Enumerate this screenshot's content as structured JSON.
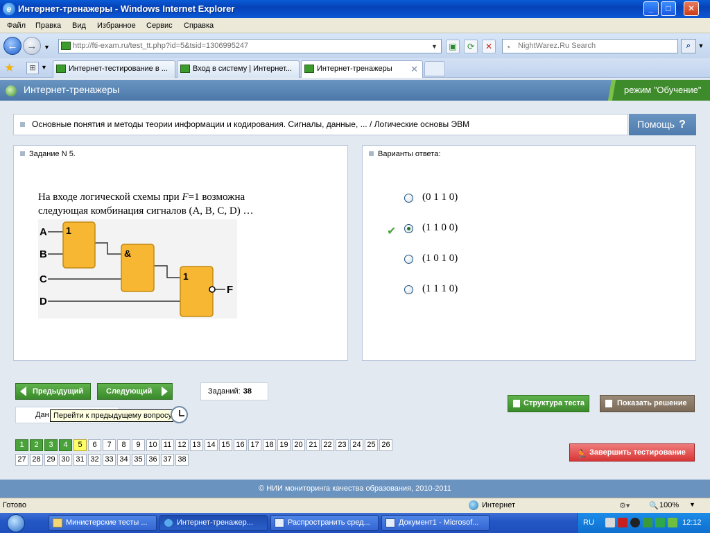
{
  "window": {
    "title": "Интернет-тренажеры - Windows Internet Explorer",
    "minimize": "_",
    "maximize": "□",
    "close": "✕"
  },
  "menu": [
    "Файл",
    "Правка",
    "Вид",
    "Избранное",
    "Сервис",
    "Справка"
  ],
  "address": {
    "url": "http://fti-exam.ru/test_tt.php?id=5&tsid=1306995247",
    "search_placeholder": "NightWarez.Ru Search"
  },
  "tabs": [
    {
      "label": "Интернет-тестирование в ...",
      "active": false
    },
    {
      "label": "Вход в систему | Интернет...",
      "active": false
    },
    {
      "label": "Интернет-тренажеры",
      "active": true
    }
  ],
  "site": {
    "title": "Интернет-тренажеры",
    "mode": "режим \"Обучение\"",
    "breadcrumb": "Основные понятия и методы теории информации и кодирования. Сигналы, данные, ... / Логические основы ЭВМ",
    "help": "Помощь",
    "help_icon": "?"
  },
  "question": {
    "header": "Задание N 5.",
    "text_line1_a": "На входе логической схемы при ",
    "text_line1_var": "F",
    "text_line1_b": "=1 возможна",
    "text_line2": "следующая комбинация сигналов (A, B, C, D) …",
    "diagram": {
      "inputs": [
        "A",
        "B",
        "C",
        "D"
      ],
      "gate1": "1",
      "gate2": "&",
      "gate3": "1",
      "output": "F"
    }
  },
  "answers": {
    "header": "Варианты ответа:",
    "options": [
      {
        "label": "(0 1 1 0)",
        "selected": false
      },
      {
        "label": "(1 1 0 0)",
        "selected": true
      },
      {
        "label": "(1 0 1 0)",
        "selected": false
      },
      {
        "label": "(1 1 1 0)",
        "selected": false
      }
    ]
  },
  "controls": {
    "prev": "Предыдущий",
    "next": "Следующий",
    "count_label": "Заданий:",
    "count_value": "38",
    "timer_text": "Дан",
    "tooltip": "Перейти к предыдущему вопросу",
    "structure": "Структура теста",
    "show_solution": "Показать решение",
    "finish": "Завершить тестирование"
  },
  "question_numbers": {
    "total": 38,
    "done": [
      1,
      2,
      3,
      4
    ],
    "current": 5
  },
  "footer": "© НИИ мониторинга качества образования, 2010-2011",
  "status": {
    "text": "Готово",
    "zone": "Интернет",
    "zoom": "100%"
  },
  "taskbar": {
    "items": [
      {
        "label": "Министерские тесты ...",
        "icon": "folder-icon"
      },
      {
        "label": "Интернет-тренажер...",
        "icon": "ie-icon"
      },
      {
        "label": "Распространить сред...",
        "icon": "word-icon"
      },
      {
        "label": "Документ1 - Microsof...",
        "icon": "word-icon"
      }
    ],
    "lang": "RU",
    "time": "12:12"
  }
}
